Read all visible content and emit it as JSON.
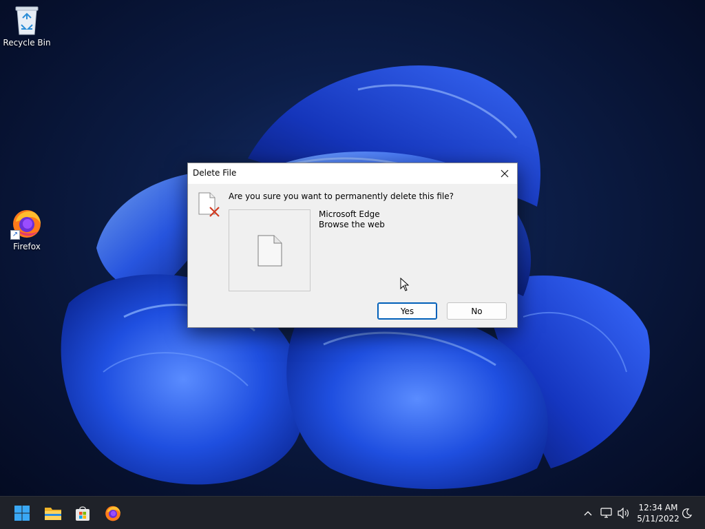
{
  "desktop": {
    "icons": [
      {
        "label": "Recycle Bin",
        "icon": "recycle-bin-icon"
      },
      {
        "label": "Firefox",
        "icon": "firefox-icon"
      }
    ]
  },
  "dialog": {
    "title": "Delete File",
    "question": "Are you sure you want to permanently delete this file?",
    "file_name": "Microsoft Edge",
    "file_description": "Browse the web",
    "yes_label": "Yes",
    "no_label": "No",
    "close_icon": "close-icon"
  },
  "taskbar": {
    "pinned": [
      "start-icon",
      "file-explorer-icon",
      "microsoft-store-icon",
      "firefox-icon"
    ],
    "tray": {
      "time": "12:34 AM",
      "date": "5/11/2022",
      "icons": [
        "chevron-up-icon",
        "network-icon",
        "volume-icon",
        "focus-assist-icon"
      ]
    }
  },
  "colors": {
    "accent": "#005fb8",
    "taskbar": "#1f2229",
    "dialog_bg": "#f0f0f0",
    "delete_x": "#d13b21"
  }
}
